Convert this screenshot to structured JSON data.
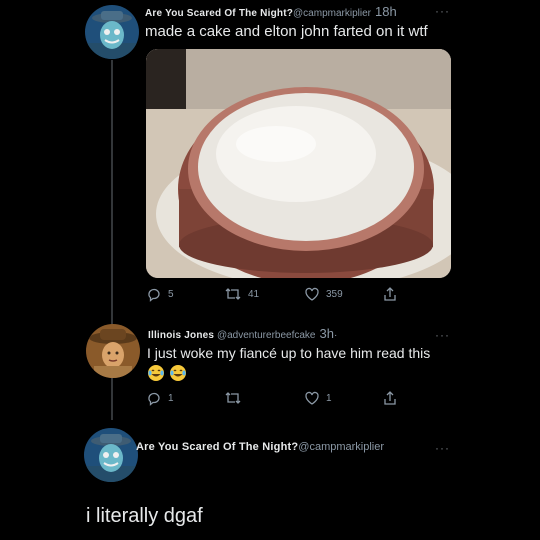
{
  "tweets": [
    {
      "author_name": "Are You Scared Of The Night?",
      "handle": "@campmarkiplier",
      "time": "18h",
      "text": "made a cake and elton john farted on it wtf",
      "replies": "5",
      "retweets": "41",
      "likes": "359"
    },
    {
      "author_name": "Illinois Jones",
      "handle": "@adventurerbeefcake",
      "time": "3h",
      "dot": "·",
      "text": "I just woke my fiancé up to have him read this",
      "emoji": [
        "laughing-crying",
        "laughing-crying"
      ],
      "replies": "1",
      "likes": "1"
    },
    {
      "author_name": "Are You Scared Of The Night?",
      "handle": "@campmarkiplier",
      "text": "i literally dgaf"
    }
  ],
  "more_glyph": "···",
  "colors": {
    "background": "#000000",
    "text": "#e7e9ea",
    "secondary": "#8b98a5",
    "thread_line": "#333639"
  },
  "icons": [
    "reply-icon",
    "retweet-icon",
    "like-icon",
    "share-icon",
    "more-icon",
    "laughing-crying-emoji"
  ]
}
